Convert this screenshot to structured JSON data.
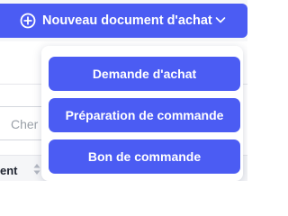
{
  "toolbar": {
    "new_purchase_document_label": "Nouveau document d'achat"
  },
  "dropdown": {
    "items": [
      {
        "label": "Demande d'achat"
      },
      {
        "label": "Préparation de commande"
      },
      {
        "label": "Bon de commande"
      }
    ]
  },
  "search": {
    "placeholder": "Cher"
  },
  "table": {
    "header_label": "ent"
  },
  "colors": {
    "accent": "#4b5cf3",
    "text_dark": "#1f2430"
  },
  "icons": {
    "add": "plus-circle-icon",
    "chevron": "chevron-down-icon",
    "sort": "sort-icon"
  }
}
